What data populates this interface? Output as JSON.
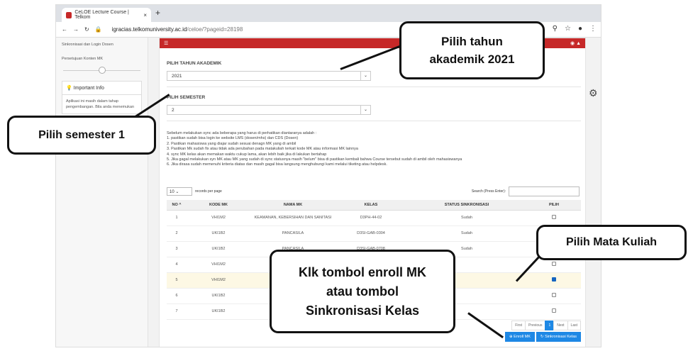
{
  "browser": {
    "tab_title": "CeLOE Lecture Course | Telkom",
    "url_domain": "igracias.telkomuniversity.ac.id",
    "url_path": "/celoe/?pageid=28198",
    "new_tab": "+",
    "close": "×"
  },
  "sidebar": {
    "items": [
      "Sinkronisasi dan Login Dosen",
      "Persetujuan Konten MK"
    ],
    "info_title": "Important Info",
    "info_text": "Aplikasi ini masih dalam tahap pengembangan. Bila anda menemukan"
  },
  "panel": {
    "academic_year_label": "PILIH TAHUN AKADEMIK",
    "academic_year_value": "2021",
    "semester_label": "PILIH SEMESTER",
    "semester_value": "2",
    "notes": [
      "Sebelum melakukan sync ada beberapa yang harus di perhatikan diantaranya adalah :",
      "1. pastikan sudah bisa login ke website LMS (dosen/mhs) dan CDS (Dosen)",
      "2. Pastikan mahasiswa yang diajar sudah sesuai denagn MK yang di ambil",
      "3. Pastikan Mk sudah fix atau tidak ada perubahan pada matakuliah terkait kode MK atau informasi MK lainnya",
      "4. sync MK kelas akan memakan waktu cukup lama, akan lebih baik jika di lakukan bertahap",
      "5. Jika gagal melakukan syn MK atau MK yang sudah di sync statusnya masih \"belum\" bisa di pastikan kembali bahwa Course tersebut sudah di ambil oleh mahasiswanya",
      "6. Jika dirasa sudah memenuhi kriteria diatas dan masih gagal bisa langsung menghubungi kami melalui tiketing atau helpdesk."
    ],
    "records_value": "10",
    "records_label": "records per page",
    "search_label": "Search (Press Enter):",
    "columns": [
      "NO ^",
      "KODE MK",
      "NAMA MK",
      "KELAS",
      "STATUS SINKRONISASI",
      "PILIH"
    ],
    "rows": [
      {
        "no": "1",
        "kode": "VHI1M2",
        "nama": "KEAMANAN, KEBERSIHAN DAN SANITASI",
        "kelas": "D3PH-44-02",
        "status": "Sudah",
        "checked": false
      },
      {
        "no": "2",
        "kode": "UKI1B2",
        "nama": "PANCASILA",
        "kelas": "D3SI-GAB-0304",
        "status": "Sudah",
        "checked": false
      },
      {
        "no": "3",
        "kode": "UKI1B2",
        "nama": "PANCASILA",
        "kelas": "D3SI-GAB-0708",
        "status": "Sudah",
        "checked": false
      },
      {
        "no": "4",
        "kode": "VHI1M2",
        "nama": "KEAM",
        "kelas": "",
        "status": "",
        "checked": false
      },
      {
        "no": "5",
        "kode": "VHI1M2",
        "nama": "KEAM",
        "kelas": "",
        "status": "",
        "checked": true
      },
      {
        "no": "6",
        "kode": "UKI1B2",
        "nama": "",
        "kelas": "",
        "status": "",
        "checked": false
      },
      {
        "no": "7",
        "kode": "UKI1B2",
        "nama": "",
        "kelas": "",
        "status": "",
        "checked": false
      }
    ],
    "pager": [
      "First",
      "Previous",
      "1",
      "Next",
      "Last"
    ],
    "enroll_label": "Enroll MK",
    "sync_label": "Sinkronisasi Kelas"
  },
  "callouts": {
    "year": [
      "Pilih tahun",
      "akademik 2021"
    ],
    "semester": "Pilih semester 1",
    "course": "Pilih Mata Kuliah",
    "enroll": [
      "Klk tombol enroll MK",
      "atau tombol",
      "Sinkronisasi Kelas"
    ]
  }
}
